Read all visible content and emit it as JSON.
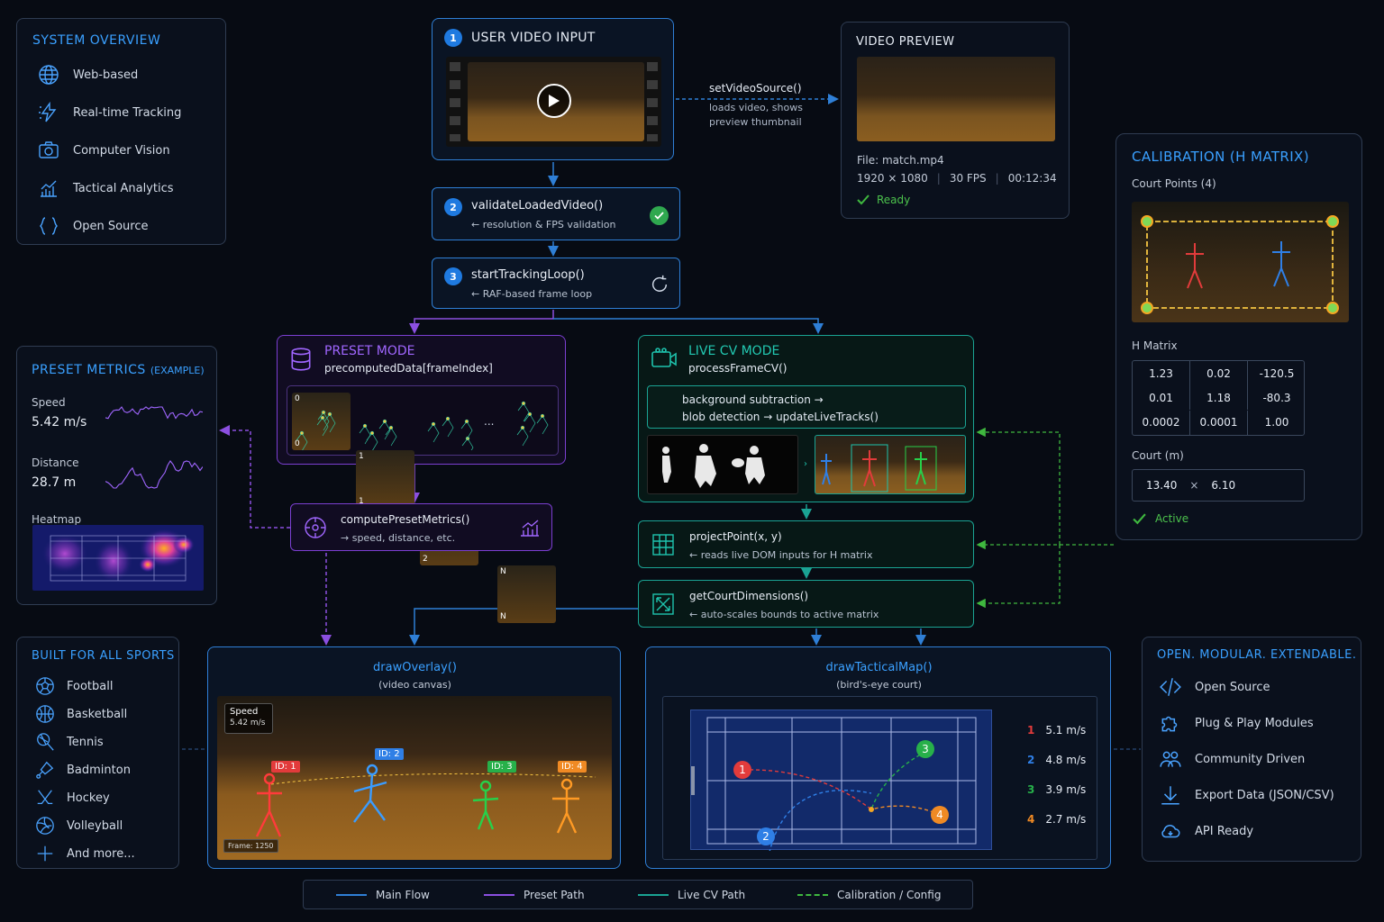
{
  "overview": {
    "title": "SYSTEM OVERVIEW",
    "items": [
      {
        "icon": "globe-icon",
        "label": "Web-based"
      },
      {
        "icon": "lightning-icon",
        "label": "Real-time Tracking"
      },
      {
        "icon": "camera-icon",
        "label": "Computer Vision"
      },
      {
        "icon": "analytics-chart-icon",
        "label": "Tactical Analytics"
      },
      {
        "icon": "braces-icon",
        "label": "Open Source"
      }
    ]
  },
  "input": {
    "step": "1",
    "title": "USER VIDEO INPUT"
  },
  "setsource": {
    "fn": "setVideoSource()",
    "desc1": "loads video, shows",
    "desc2": "preview thumbnail"
  },
  "preview": {
    "title": "VIDEO PREVIEW",
    "file": "File: match.mp4",
    "res": "1920 × 1080",
    "fps": "30 FPS",
    "duration": "00:12:34",
    "status": "Ready"
  },
  "validate": {
    "step": "2",
    "fn": "validateLoadedVideo()",
    "desc": "← resolution & FPS validation"
  },
  "tracking": {
    "step": "3",
    "fn": "startTrackingLoop()",
    "desc": "← RAF-based frame loop"
  },
  "preset": {
    "title": "PRESET MODE",
    "fn": "precomputedData[frameIndex]",
    "frames_top": [
      "0",
      "1",
      "2",
      "N"
    ],
    "frames_bottom": [
      "0",
      "1",
      "2",
      "N"
    ],
    "ellipsis": "..."
  },
  "live": {
    "title": "LIVE CV MODE",
    "fn": "processFrameCV()",
    "step1": "background subtraction →",
    "step2": "blob detection → updateLiveTracks()"
  },
  "metrics": {
    "title": "PRESET METRICS",
    "title_note": "(EXAMPLE)",
    "speed_label": "Speed",
    "speed_value": "5.42 m/s",
    "distance_label": "Distance",
    "distance_value": "28.7 m",
    "heatmap_label": "Heatmap"
  },
  "compute": {
    "fn": "computePresetMetrics()",
    "desc": "→ speed, distance, etc."
  },
  "project": {
    "fn": "projectPoint(x, y)",
    "desc": "← reads live DOM inputs for H matrix"
  },
  "courtdim": {
    "fn": "getCourtDimensions()",
    "desc": "← auto-scales bounds to active matrix"
  },
  "calibration": {
    "title": "CALIBRATION (H MATRIX)",
    "court_points": "Court Points (4)",
    "h_label": "H Matrix",
    "matrix": [
      [
        "1.23",
        "0.02",
        "-120.5"
      ],
      [
        "0.01",
        "1.18",
        "-80.3"
      ],
      [
        "0.0002",
        "0.0001",
        "1.00"
      ]
    ],
    "court_label": "Court (m)",
    "court_w": "13.40",
    "court_x": "×",
    "court_h": "6.10",
    "status": "Active"
  },
  "sports": {
    "title": "BUILT FOR ALL SPORTS",
    "items": [
      {
        "icon": "football-icon",
        "label": "Football"
      },
      {
        "icon": "basketball-icon",
        "label": "Basketball"
      },
      {
        "icon": "tennis-icon",
        "label": "Tennis"
      },
      {
        "icon": "badminton-icon",
        "label": "Badminton"
      },
      {
        "icon": "hockey-icon",
        "label": "Hockey"
      },
      {
        "icon": "volleyball-icon",
        "label": "Volleyball"
      },
      {
        "icon": "plus-icon",
        "label": "And more..."
      }
    ]
  },
  "overlay": {
    "fn": "drawOverlay()",
    "sub": "(video canvas)",
    "speed_label": "Speed",
    "speed_value": "5.42 m/s",
    "frame": "Frame: 1250",
    "ids": [
      "ID: 1",
      "ID: 2",
      "ID: 3",
      "ID: 4"
    ]
  },
  "tactical": {
    "fn": "drawTacticalMap()",
    "sub": "(bird's-eye court)",
    "players": [
      {
        "id": "1",
        "speed": "5.1 m/s",
        "color": "#e23b3b"
      },
      {
        "id": "2",
        "speed": "4.8 m/s",
        "color": "#2f7fe6"
      },
      {
        "id": "3",
        "speed": "3.9 m/s",
        "color": "#27b04a"
      },
      {
        "id": "4",
        "speed": "2.7 m/s",
        "color": "#f08a24"
      }
    ]
  },
  "open": {
    "title": "OPEN. MODULAR. EXTENDABLE.",
    "items": [
      {
        "icon": "code-icon",
        "label": "Open Source"
      },
      {
        "icon": "puzzle-icon",
        "label": "Plug & Play Modules"
      },
      {
        "icon": "community-icon",
        "label": "Community Driven"
      },
      {
        "icon": "download-icon",
        "label": "Export Data (JSON/CSV)"
      },
      {
        "icon": "cloud-icon",
        "label": "API Ready"
      }
    ]
  },
  "legend": {
    "main": "Main Flow",
    "preset": "Preset Path",
    "live": "Live CV Path",
    "calib": "Calibration / Config"
  },
  "colors": {
    "blue": "#2f7fd6",
    "purple": "#7b3fd1",
    "teal": "#1aa393",
    "green": "#3fb83f",
    "accent": "#3aa0ff"
  }
}
